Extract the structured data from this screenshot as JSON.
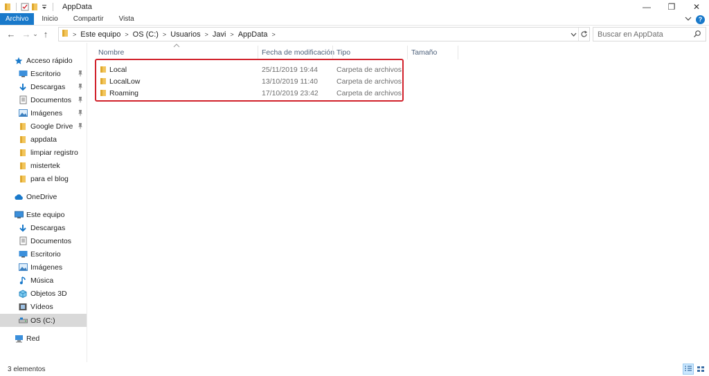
{
  "window": {
    "title": "AppData",
    "controls": {
      "minimize": "—",
      "restore": "❐",
      "close": "✕"
    }
  },
  "ribbon": {
    "tabs": [
      "Archivo",
      "Inicio",
      "Compartir",
      "Vista"
    ],
    "help": "?"
  },
  "nav": {
    "back": "←",
    "forward": "→",
    "recent": "⌄",
    "up": "↑"
  },
  "address": {
    "crumbs": [
      "Este equipo",
      "OS (C:)",
      "Usuarios",
      "Javi",
      "AppData"
    ]
  },
  "search": {
    "placeholder": "Buscar en AppData"
  },
  "sidebar": {
    "quick_access": {
      "label": "Acceso rápido",
      "icon": "star-icon",
      "color": "#1979ca"
    },
    "quick_items": [
      {
        "label": "Escritorio",
        "icon": "desktop-icon",
        "pinned": true
      },
      {
        "label": "Descargas",
        "icon": "download-icon",
        "pinned": true
      },
      {
        "label": "Documentos",
        "icon": "documents-icon",
        "pinned": true
      },
      {
        "label": "Imágenes",
        "icon": "pictures-icon",
        "pinned": true
      },
      {
        "label": "Google Drive",
        "icon": "folder-icon",
        "pinned": true
      },
      {
        "label": "appdata",
        "icon": "folder-icon",
        "pinned": false
      },
      {
        "label": "limpiar registro",
        "icon": "folder-icon",
        "pinned": false
      },
      {
        "label": "mistertek",
        "icon": "folder-icon",
        "pinned": false
      },
      {
        "label": "para el blog",
        "icon": "folder-icon",
        "pinned": false
      }
    ],
    "onedrive": {
      "label": "OneDrive",
      "icon": "cloud-icon"
    },
    "this_pc": {
      "label": "Este equipo",
      "icon": "computer-icon"
    },
    "pc_items": [
      {
        "label": "Descargas",
        "icon": "download-icon"
      },
      {
        "label": "Documentos",
        "icon": "documents-icon"
      },
      {
        "label": "Escritorio",
        "icon": "desktop-icon"
      },
      {
        "label": "Imágenes",
        "icon": "pictures-icon"
      },
      {
        "label": "Música",
        "icon": "music-icon"
      },
      {
        "label": "Objetos 3D",
        "icon": "cube-icon"
      },
      {
        "label": "Vídeos",
        "icon": "video-icon"
      },
      {
        "label": "OS (C:)",
        "icon": "drive-icon",
        "selected": true
      }
    ],
    "network": {
      "label": "Red",
      "icon": "network-icon"
    }
  },
  "columns": {
    "name": "Nombre",
    "date": "Fecha de modificación",
    "type": "Tipo",
    "size": "Tamaño"
  },
  "files": [
    {
      "name": "Local",
      "date": "25/11/2019 19:44",
      "type": "Carpeta de archivos"
    },
    {
      "name": "LocalLow",
      "date": "13/10/2019 11:40",
      "type": "Carpeta de archivos"
    },
    {
      "name": "Roaming",
      "date": "17/10/2019 23:42",
      "type": "Carpeta de archivos"
    }
  ],
  "status": {
    "count": "3 elementos"
  },
  "colors": {
    "accent": "#1979ca",
    "highlight": "#d1202a",
    "folder": "#f2c55c"
  }
}
